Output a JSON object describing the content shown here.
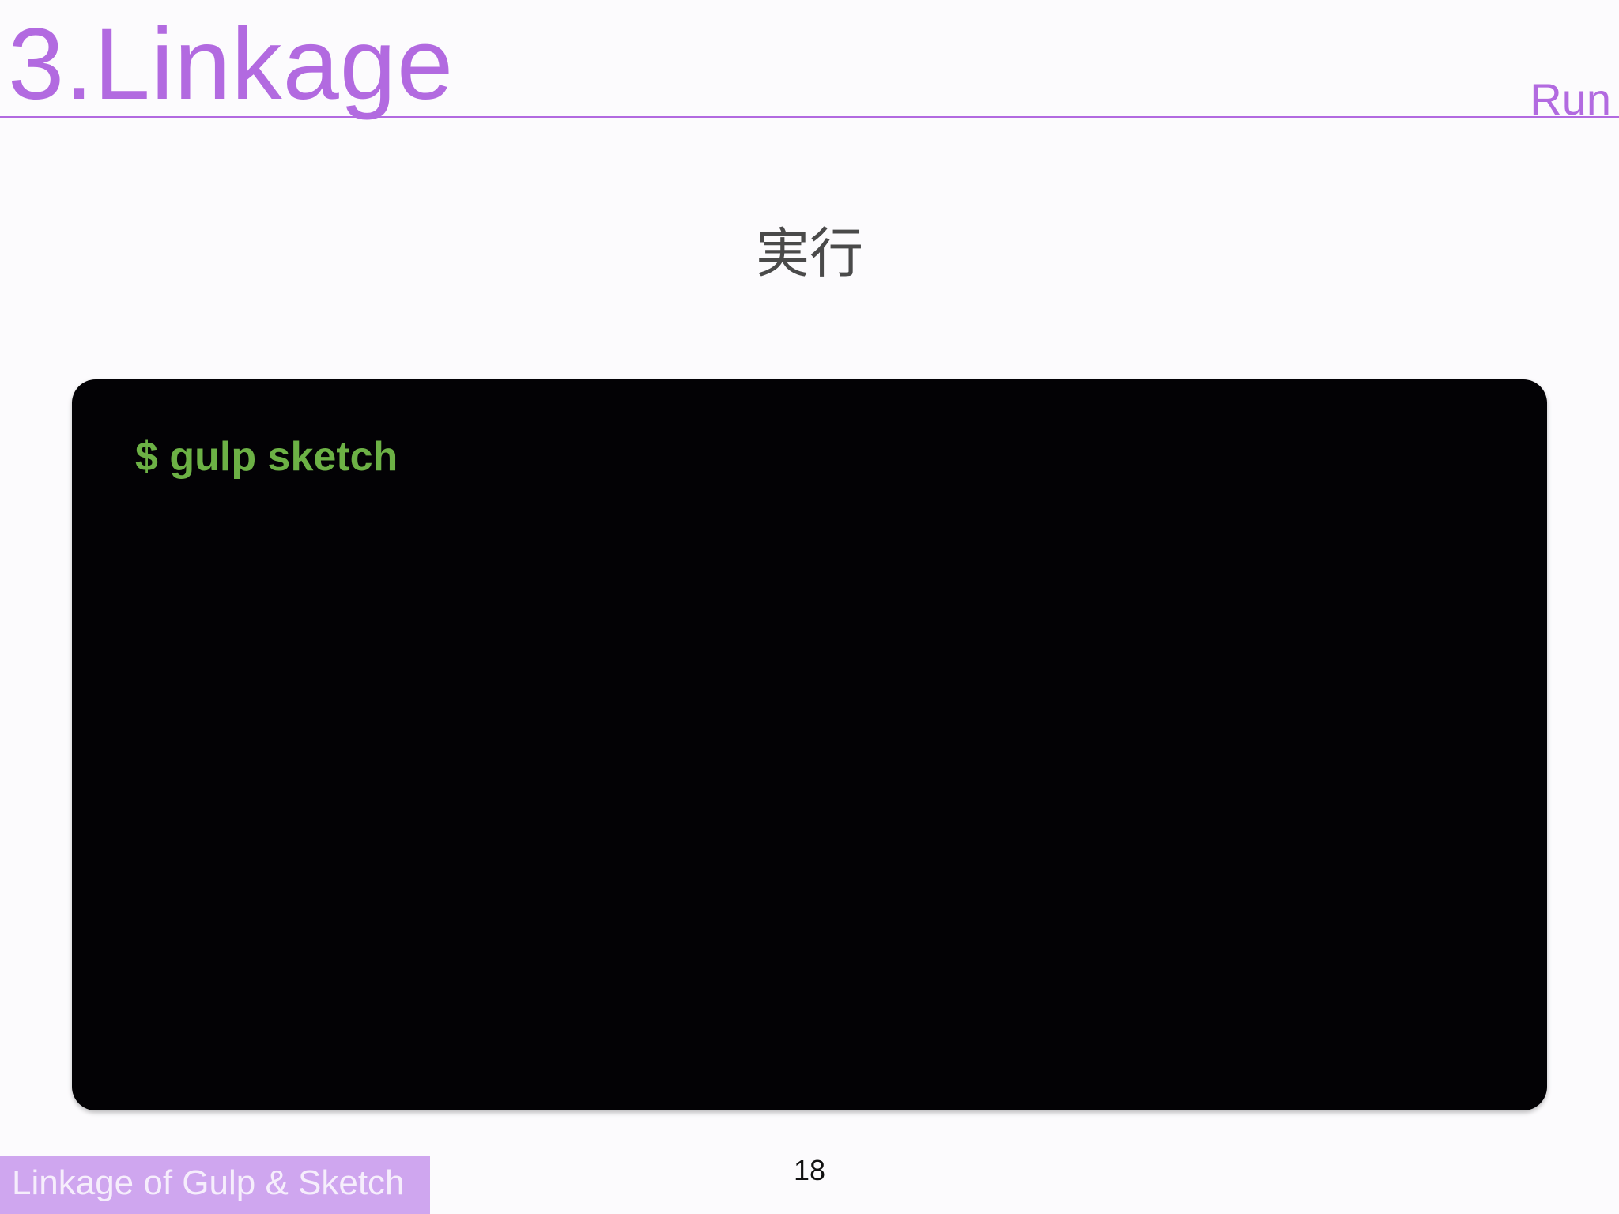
{
  "header": {
    "title": "3.Linkage",
    "section": "Run"
  },
  "main": {
    "subtitle": "実行",
    "terminal": {
      "command": "$ gulp sketch"
    }
  },
  "footer": {
    "deck_name": "Linkage of Gulp & Sketch",
    "page_number": "18"
  },
  "colors": {
    "accent": "#b26ae0",
    "footer_badge": "#cfa6ef",
    "terminal_background": "#030205",
    "command_text": "#6cb145",
    "subtitle_text": "#4a4a4a"
  }
}
